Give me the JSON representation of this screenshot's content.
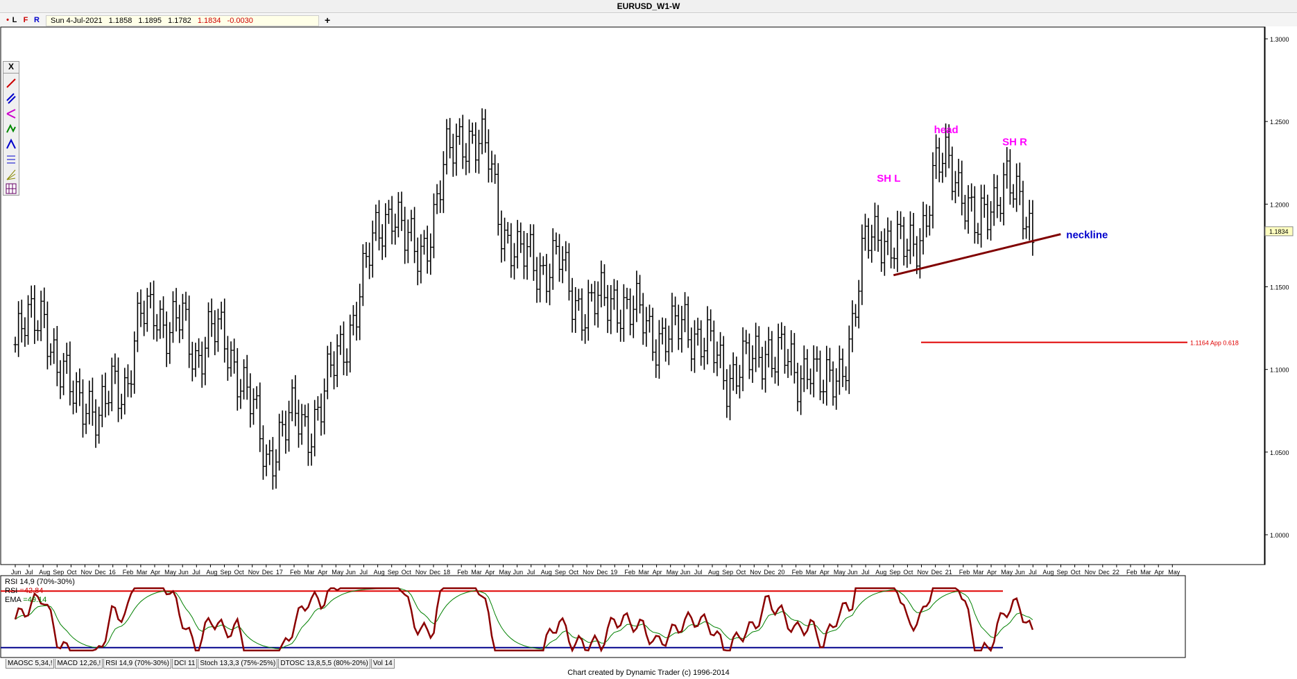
{
  "window": {
    "title": "EURUSD_W1-W"
  },
  "toolbar": {
    "left_buttons": [
      {
        "label": "L",
        "color": "#000000"
      },
      {
        "label": "F",
        "color": "#cc0000"
      },
      {
        "label": "R",
        "color": "#0000cc"
      }
    ],
    "ohlc": {
      "date": "Sun 4-Jul-2021",
      "open": "1.1858",
      "high": "1.1895",
      "low": "1.1782",
      "close": "1.1834",
      "change": "-0.0030"
    },
    "add_label": "+"
  },
  "toolbox": {
    "close_label": "X",
    "tools": [
      "trendline-icon",
      "parallel-icon",
      "pitchfork-icon",
      "abc-icon",
      "projection-icon",
      "retrace-icon",
      "gann-fan-icon",
      "grid-icon"
    ]
  },
  "chart_data": [
    {
      "type": "ohlc",
      "title": "EURUSD_W1-W",
      "ylim": [
        0.992,
        1.313
      ],
      "y_ticks": [
        "1.3000",
        "1.2500",
        "1.2000",
        "1.1500",
        "1.1000",
        "1.0500",
        "1.0000"
      ],
      "last_price_label": "1.1834",
      "x_labels": [
        "Jun",
        "Jul",
        "Aug",
        "Sep",
        "Oct",
        "Nov",
        "Dec",
        "16",
        "Feb",
        "Mar",
        "Apr",
        "May",
        "Jun",
        "Jul",
        "Aug",
        "Sep",
        "Oct",
        "Nov",
        "Dec",
        "17",
        "Feb",
        "Mar",
        "Apr",
        "May",
        "Jun",
        "Jul",
        "Aug",
        "Sep",
        "Oct",
        "Nov",
        "Dec",
        "18",
        "Feb",
        "Mar",
        "Apr",
        "May",
        "Jun",
        "Jul",
        "Aug",
        "Sep",
        "Oct",
        "Nov",
        "Dec",
        "19",
        "Feb",
        "Mar",
        "Apr",
        "May",
        "Jun",
        "Jul",
        "Aug",
        "Sep",
        "Oct",
        "Nov",
        "Dec",
        "20",
        "Feb",
        "Mar",
        "Apr",
        "May",
        "Jun",
        "Jul",
        "Aug",
        "Sep",
        "Oct",
        "Nov",
        "Dec",
        "21",
        "Feb",
        "Mar",
        "Apr",
        "May",
        "Jun",
        "Jul",
        "Aug",
        "Sep",
        "Oct",
        "Nov",
        "Dec",
        "22",
        "Feb",
        "Mar",
        "Apr",
        "May",
        "Jun",
        "Jul",
        "A"
      ],
      "price_path_anchors": [
        [
          "Jun 2015",
          1.115
        ],
        [
          "Aug 2015",
          1.14
        ],
        [
          "Sep 2015",
          1.095
        ],
        [
          "Nov 2015",
          1.085
        ],
        [
          "Dec 2015",
          1.062
        ],
        [
          "Jan 2016",
          1.098
        ],
        [
          "Feb 2016",
          1.088
        ],
        [
          "Mar 2016",
          1.13
        ],
        [
          "Apr 2016",
          1.142
        ],
        [
          "May 2016",
          1.12
        ],
        [
          "Jun 2016",
          1.13
        ],
        [
          "Jul 2016",
          1.108
        ],
        [
          "Aug 2016",
          1.122
        ],
        [
          "Sep 2016",
          1.118
        ],
        [
          "Oct 2016",
          1.1
        ],
        [
          "Nov 2016",
          1.075
        ],
        [
          "Dec 2016",
          1.045
        ],
        [
          "Jan 2017",
          1.062
        ],
        [
          "Feb 2017",
          1.07
        ],
        [
          "Mar 2017",
          1.065
        ],
        [
          "Apr 2017",
          1.08
        ],
        [
          "May 2017",
          1.105
        ],
        [
          "Jun 2017",
          1.125
        ],
        [
          "Jul 2017",
          1.155
        ],
        [
          "Aug 2017",
          1.185
        ],
        [
          "Sep 2017",
          1.2
        ],
        [
          "Oct 2017",
          1.175
        ],
        [
          "Nov 2017",
          1.172
        ],
        [
          "Dec 2017",
          1.19
        ],
        [
          "Jan 2018",
          1.228
        ],
        [
          "Feb 2018",
          1.245
        ],
        [
          "Mar 2018",
          1.235
        ],
        [
          "Apr 2018",
          1.228
        ],
        [
          "May 2018",
          1.185
        ],
        [
          "Jun 2018",
          1.165
        ],
        [
          "Jul 2018",
          1.17
        ],
        [
          "Aug 2018",
          1.16
        ],
        [
          "Sep 2018",
          1.165
        ],
        [
          "Oct 2018",
          1.145
        ],
        [
          "Nov 2018",
          1.135
        ],
        [
          "Dec 2018",
          1.14
        ],
        [
          "Jan 2019",
          1.145
        ],
        [
          "Feb 2019",
          1.133
        ],
        [
          "Mar 2019",
          1.132
        ],
        [
          "Apr 2019",
          1.12
        ],
        [
          "May 2019",
          1.118
        ],
        [
          "Jun 2019",
          1.13
        ],
        [
          "Jul 2019",
          1.12
        ],
        [
          "Aug 2019",
          1.11
        ],
        [
          "Sep 2019",
          1.095
        ],
        [
          "Oct 2019",
          1.105
        ],
        [
          "Nov 2019",
          1.102
        ],
        [
          "Dec 2019",
          1.115
        ],
        [
          "Jan 2020",
          1.11
        ],
        [
          "Feb 2020",
          1.09
        ],
        [
          "Mar 2020",
          1.11
        ],
        [
          "Apr 2020",
          1.085
        ],
        [
          "May 2020",
          1.095
        ],
        [
          "Jun 2020",
          1.125
        ],
        [
          "Jul 2020",
          1.175
        ],
        [
          "Aug 2020",
          1.185
        ],
        [
          "Sep 2020",
          1.175
        ],
        [
          "Oct 2020",
          1.17
        ],
        [
          "Nov 2020",
          1.185
        ],
        [
          "Dec 2020",
          1.22
        ],
        [
          "Jan 2021",
          1.225
        ],
        [
          "Feb 2021",
          1.21
        ],
        [
          "Mar 2021",
          1.18
        ],
        [
          "Apr 2021",
          1.2
        ],
        [
          "May 2021",
          1.22
        ],
        [
          "Jun 2021",
          1.195
        ],
        [
          "Jul 2021",
          1.183
        ]
      ],
      "annotations": [
        {
          "text": "SH L",
          "color": "#ff00ff"
        },
        {
          "text": "head",
          "color": "#ff00ff"
        },
        {
          "text": "SH R",
          "color": "#ff00ff"
        },
        {
          "text": "neckline",
          "color": "#0000cc"
        },
        {
          "text": "1.1164 App 0.618",
          "color": "#e00000",
          "value": 1.1164
        }
      ],
      "neckline": {
        "color": "#800000",
        "from": [
          "Sep 2020",
          1.157
        ],
        "to": [
          "Jul 2021",
          1.181
        ]
      },
      "retracement_line": {
        "value": 1.1164,
        "color": "#e00000"
      }
    },
    {
      "type": "line",
      "title": "RSI 14,9 (70%-30%)",
      "series": [
        {
          "name": "RSI",
          "label": "RSI",
          "value_text": "=42.84",
          "color": "#8b0000"
        },
        {
          "name": "EMA",
          "label": "EMA",
          "value_text": "=49.14",
          "color": "#008000"
        }
      ],
      "levels": [
        {
          "value": 70,
          "color": "#e00000"
        },
        {
          "value": 30,
          "color": "#00008b"
        }
      ],
      "ylim": [
        25,
        75
      ]
    }
  ],
  "indicator_tabs": [
    "MAOSC 5,34,!",
    "MACD 12,26,!",
    "RSI 14,9 (70%-30%)",
    "DCI 11",
    "Stoch 13,3,3 (75%-25%)",
    "DTOSC 13,8,5,5 (80%-20%)",
    "Vol 14"
  ],
  "footer": {
    "credit": "Chart created by Dynamic Trader  (c)  1996-2014"
  }
}
